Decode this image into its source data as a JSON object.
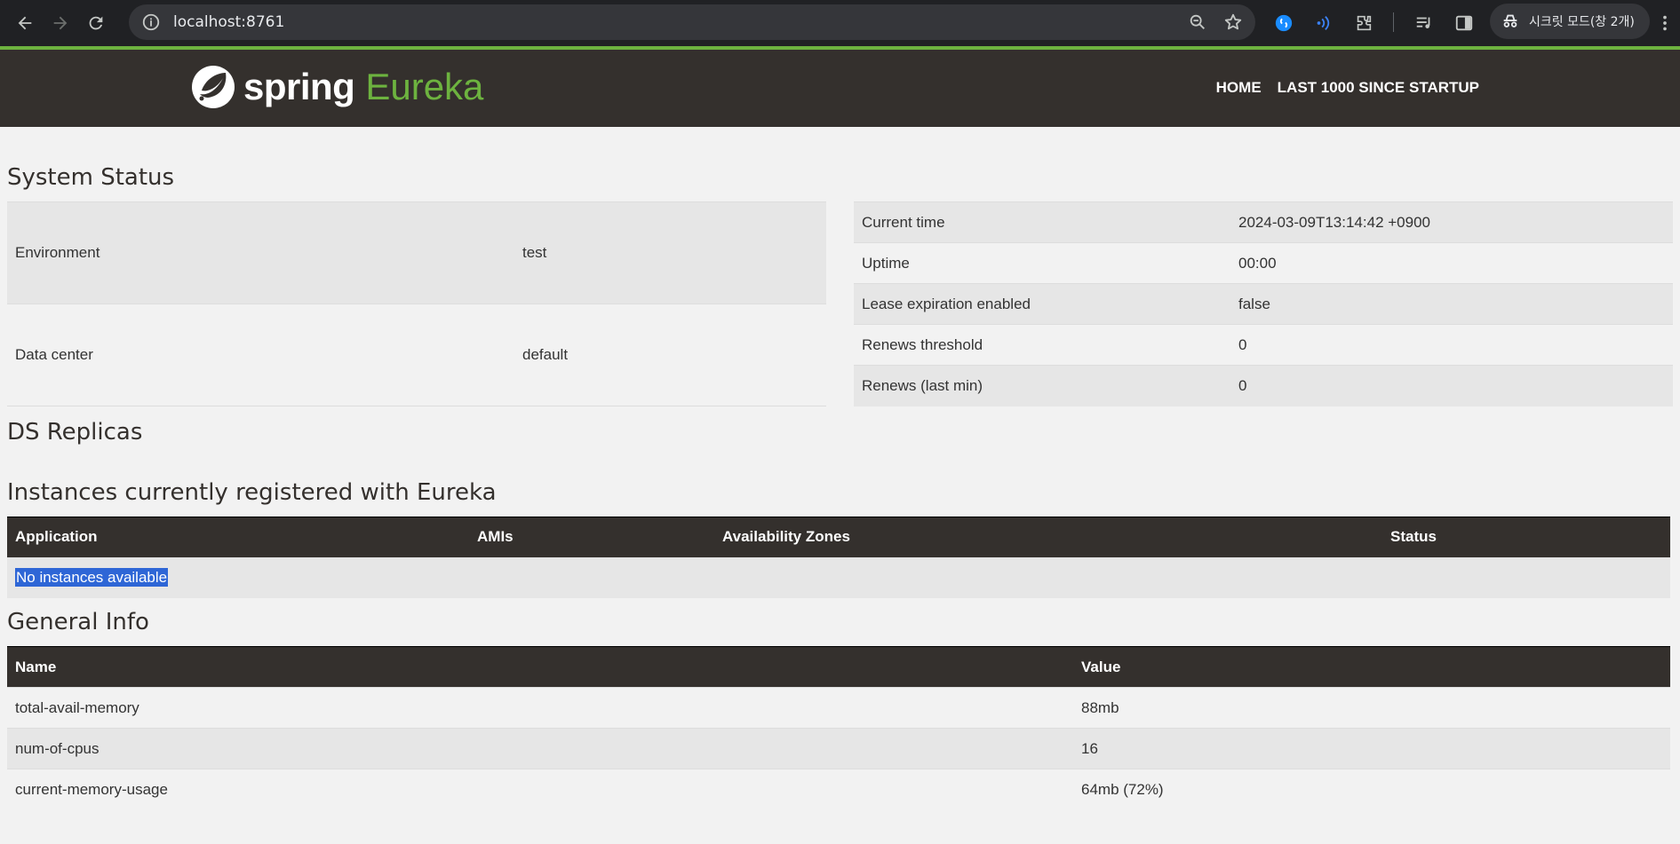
{
  "browser": {
    "url": "localhost:8761",
    "incognito_label": "시크릿 모드(창 2개)"
  },
  "header": {
    "brand_spring": "spring",
    "brand_eureka": "Eureka",
    "nav": [
      "HOME",
      "LAST 1000 SINCE STARTUP"
    ]
  },
  "system_status": {
    "title": "System Status",
    "left": [
      {
        "label": "Environment",
        "value": "test"
      },
      {
        "label": "Data center",
        "value": "default"
      }
    ],
    "right": [
      {
        "label": "Current time",
        "value": "2024-03-09T13:14:42 +0900"
      },
      {
        "label": "Uptime",
        "value": "00:00"
      },
      {
        "label": "Lease expiration enabled",
        "value": "false"
      },
      {
        "label": "Renews threshold",
        "value": "0"
      },
      {
        "label": "Renews (last min)",
        "value": "0"
      }
    ]
  },
  "ds_replicas": {
    "title": "DS Replicas"
  },
  "instances": {
    "title": "Instances currently registered with Eureka",
    "columns": [
      "Application",
      "AMIs",
      "Availability Zones",
      "Status"
    ],
    "empty_message": "No instances available"
  },
  "general_info": {
    "title": "General Info",
    "columns": [
      "Name",
      "Value"
    ],
    "rows": [
      {
        "name": "total-avail-memory",
        "value": "88mb"
      },
      {
        "name": "num-of-cpus",
        "value": "16"
      },
      {
        "name": "current-memory-usage",
        "value": "64mb (72%)"
      }
    ]
  },
  "colors": {
    "brand_green": "#6db33f",
    "header_bg": "#34302d",
    "selection": "#2e66d6"
  },
  "icons": [
    "back-icon",
    "forward-icon",
    "reload-icon",
    "info-icon",
    "zoom-icon",
    "star-icon",
    "shazam-icon",
    "read-aloud-icon",
    "extensions-icon",
    "media-icon",
    "side-panel-icon",
    "incognito-icon",
    "menu-icon",
    "spring-leaf-icon"
  ]
}
